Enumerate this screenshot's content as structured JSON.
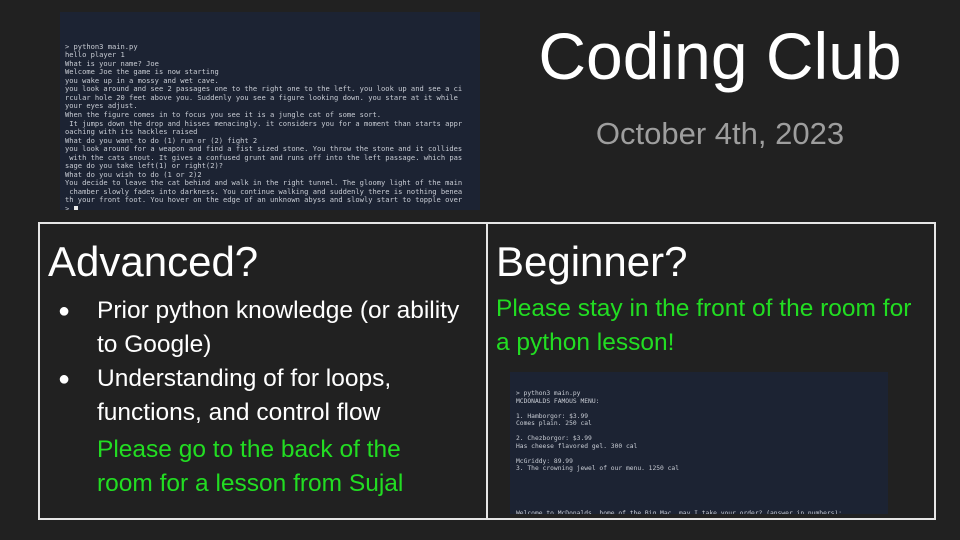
{
  "terminal_top": {
    "lines": [
      "> python3 main.py",
      "hello player 1",
      "What is your name? Joe",
      "Welcome Joe the game is now starting",
      "you wake up in a mossy and wet cave.",
      "you look around and see 2 passages one to the right one to the left. you look up and see a ci",
      "rcular hole 20 feet above you. Suddenly you see a figure looking down. you stare at it while",
      "your eyes adjust.",
      "When the figure comes in to focus you see it is a jungle cat of some sort.",
      " It jumps down the drop and hisses menacingly. it considers you for a moment than starts appr",
      "oaching with its hackles raised",
      "What do you want to do (1) run or (2) fight 2",
      "you look around for a weapon and find a fist sized stone. You throw the stone and it collides",
      " with the cats snout. It gives a confused grunt and runs off into the left passage. which pas",
      "sage do you take left(1) or right(2)?",
      "What do you wish to do (1 or 2)2",
      "You decide to leave the cat behind and walk in the right tunnel. The gloomy light of the main",
      " chamber slowly fades into darkness. You continue walking and suddenly there is nothing benea",
      "th your front foot. You hover on the edge of an unknown abyss and slowly start to topple over",
      ">"
    ],
    "icons": [
      "search-icon",
      "trash-icon"
    ]
  },
  "title": "Coding Club",
  "subtitle": "October 4th, 2023",
  "advanced": {
    "heading": "Advanced?",
    "bullets": [
      "Prior python knowledge (or ability to Google)",
      "Understanding of for loops, functions, and control flow"
    ],
    "note": "Please go to the back of the room for a lesson from Sujal"
  },
  "beginner": {
    "heading": "Beginner?",
    "note": "Please stay in the front of the room for a python lesson!"
  },
  "terminal_bottom": {
    "lines": [
      "> python3 main.py",
      "MCDONALDS FAMOUS MENU:",
      "",
      "1. Hamborgor: $3.99",
      "Comes plain. 250 cal",
      "",
      "2. Chezborgor: $3.99",
      "Has cheese flavored gel. 300 cal",
      "",
      "McGriddy: 89.99",
      "3. The crowning jewel of our menu. 1250 cal",
      "",
      "",
      "",
      "",
      "",
      "Welcome to McDonalds, home of the Big Mac, may I take your order? (answer in numbers):"
    ]
  },
  "colors": {
    "accent_green": "#22dd22",
    "subtitle_gray": "#9e9e9e",
    "terminal_bg": "#1c2333"
  }
}
